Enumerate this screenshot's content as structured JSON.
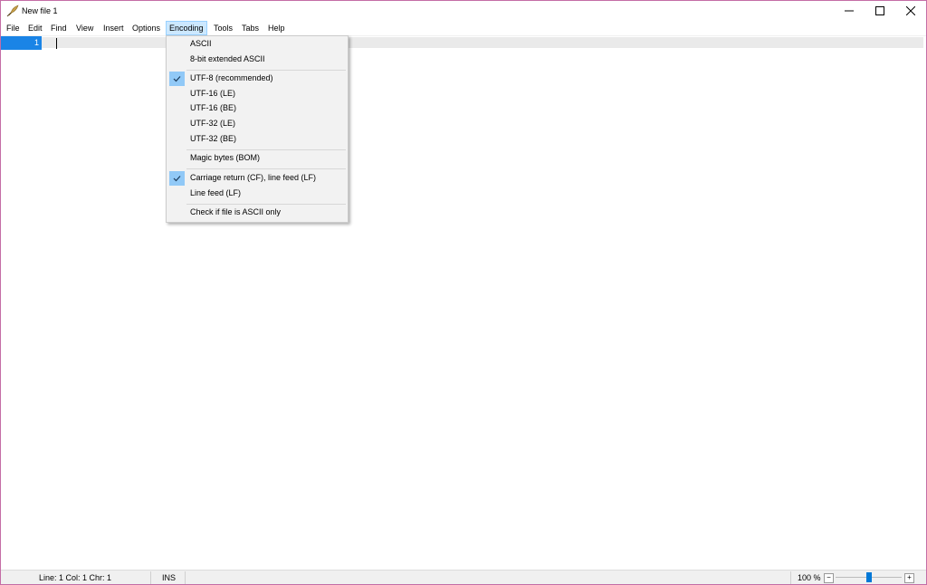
{
  "window": {
    "title": "New file 1"
  },
  "menubar": {
    "items": [
      {
        "label": "File"
      },
      {
        "label": "Edit"
      },
      {
        "label": "Find"
      },
      {
        "label": "View"
      },
      {
        "label": "Insert"
      },
      {
        "label": "Options"
      },
      {
        "label": "Encoding"
      },
      {
        "label": "Tools"
      },
      {
        "label": "Tabs"
      },
      {
        "label": "Help"
      }
    ]
  },
  "editor": {
    "line_number": "1"
  },
  "encoding_menu": {
    "items": [
      {
        "label": "ASCII",
        "checked": false
      },
      {
        "label": "8-bit extended ASCII",
        "checked": false
      },
      {
        "label": "UTF-8 (recommended)",
        "checked": true
      },
      {
        "label": "UTF-16 (LE)",
        "checked": false
      },
      {
        "label": "UTF-16 (BE)",
        "checked": false
      },
      {
        "label": "UTF-32 (LE)",
        "checked": false
      },
      {
        "label": "UTF-32 (BE)",
        "checked": false
      },
      {
        "label": "Magic bytes (BOM)",
        "checked": false
      },
      {
        "label": "Carriage return (CF), line feed (LF)",
        "checked": true
      },
      {
        "label": "Line feed (LF)",
        "checked": false
      },
      {
        "label": "Check if file is ASCII only",
        "checked": false
      }
    ]
  },
  "status": {
    "position": "Line: 1  Col: 1  Chr: 1",
    "mode": "INS",
    "zoom": "100 %",
    "zoom_minus": "−",
    "zoom_plus": "+",
    "zoom_level_fraction": 0.5
  },
  "colors": {
    "accent": "#0078d7",
    "gutter": "#1a84e6",
    "menu_highlight": "#cce8ff",
    "check_bg": "#91c9f7"
  }
}
